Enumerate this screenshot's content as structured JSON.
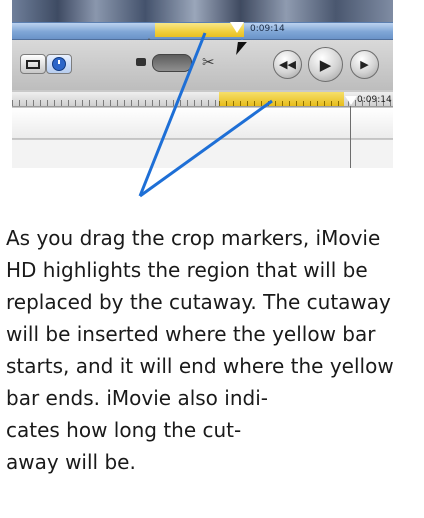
{
  "screenshot": {
    "scrubber_timecode": "0:09:14",
    "timeline_timecode": "0:09:14",
    "icons": {
      "clip_view": "filmstrip-icon",
      "timeline_view": "clock-icon",
      "zoom_small": "camera-small-icon",
      "split": "scissors-icon",
      "rewind": "rewind-icon",
      "play": "play-icon",
      "fullscreen": "fullscreen-play-icon",
      "pointer": "mouse-pointer-icon"
    },
    "colors": {
      "selection_yellow": "#f1cf3e",
      "scrubber_blue": "#7fa6d6",
      "annotation_arrow": "#1e6fd6"
    }
  },
  "caption": {
    "lines": [
      "As you drag the crop markers, iMovie",
      "HD highlights the region that will be",
      "replaced by the cutaway. The cutaway",
      "will be inserted where the yellow bar",
      "starts, and it will end where the yellow",
      "bar ends. iMovie also indi-",
      "cates how long the cut-",
      "away will be."
    ]
  }
}
